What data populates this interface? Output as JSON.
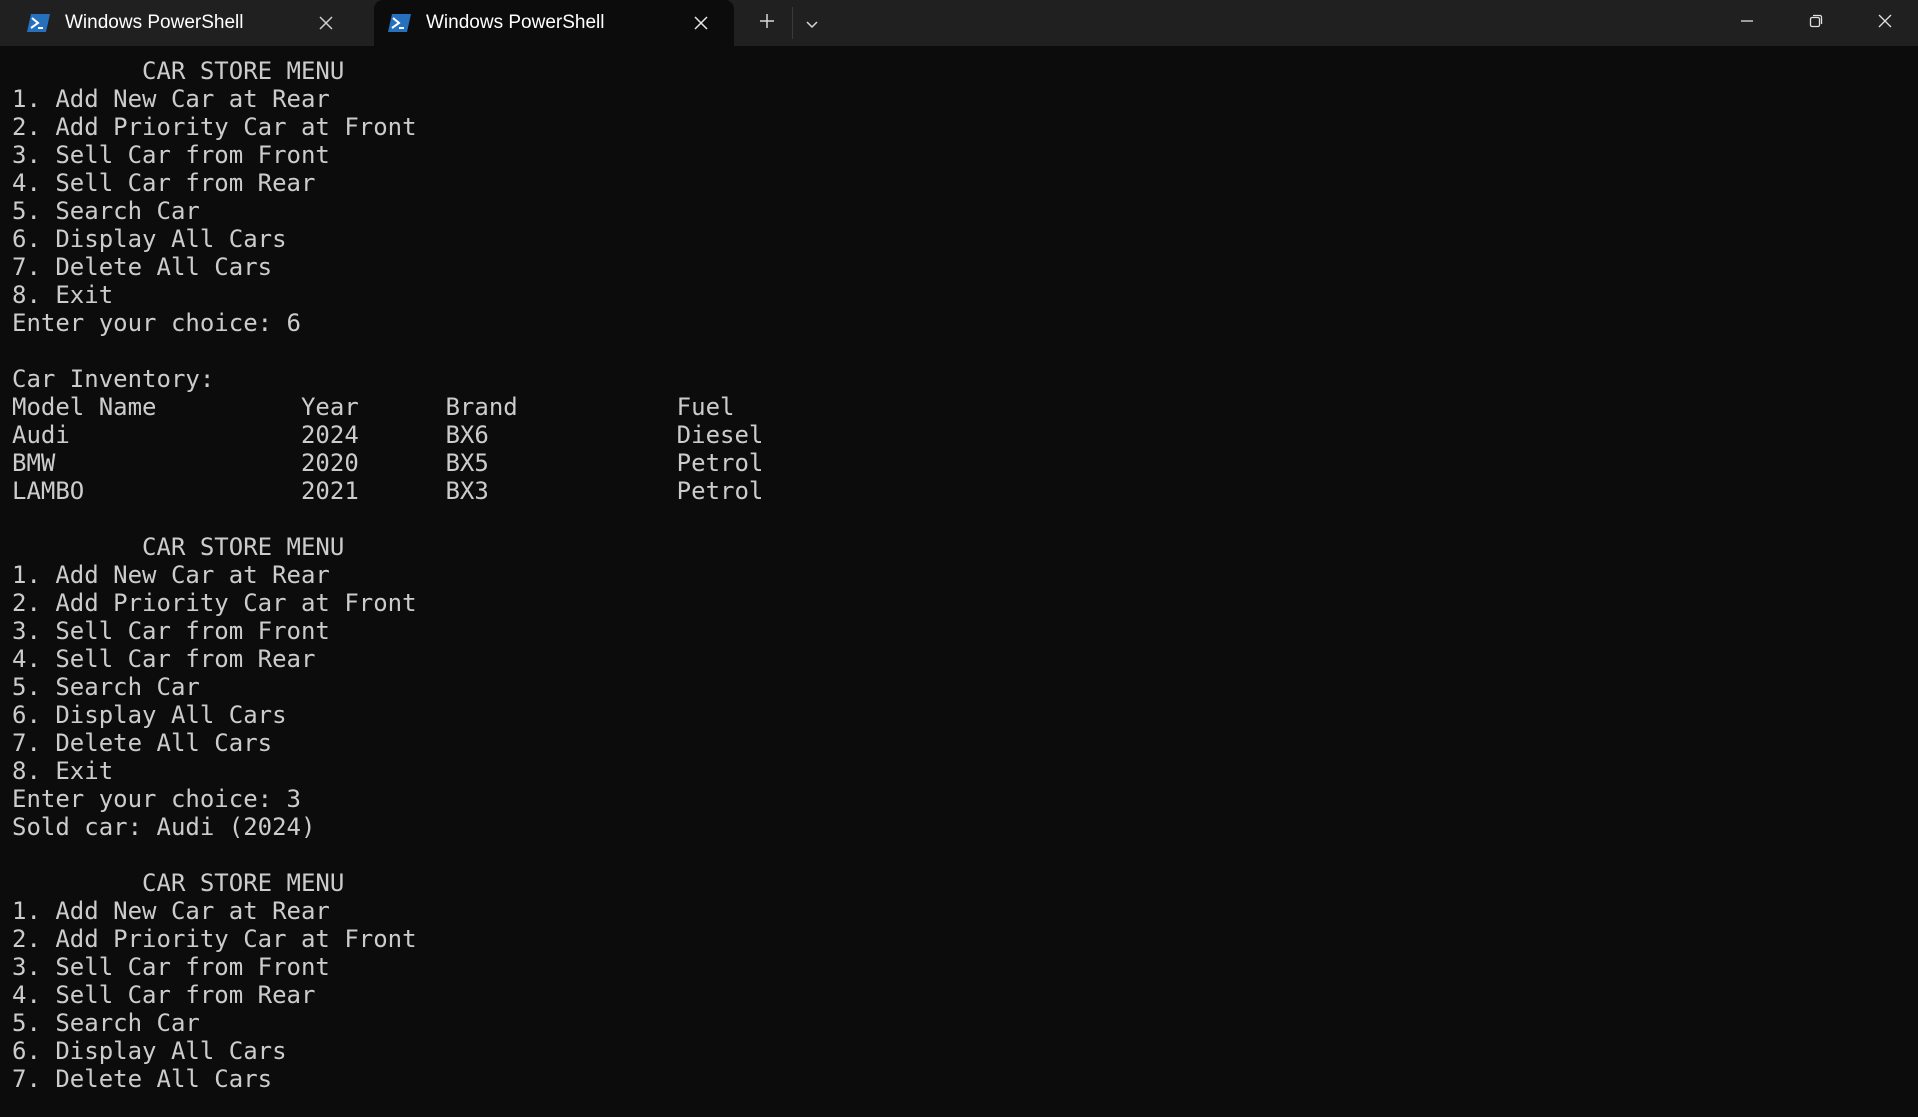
{
  "window": {
    "tabs": [
      {
        "label": "Windows PowerShell",
        "icon": "powershell-icon",
        "active": false
      },
      {
        "label": "Windows PowerShell",
        "icon": "powershell-icon",
        "active": true
      }
    ],
    "controls": [
      "new-tab-icon",
      "chevron-down-icon",
      "minimize-icon",
      "restore-icon",
      "close-icon"
    ]
  },
  "terminal": {
    "lines": [
      "         CAR STORE MENU",
      "1. Add New Car at Rear",
      "2. Add Priority Car at Front",
      "3. Sell Car from Front",
      "4. Sell Car from Rear",
      "5. Search Car",
      "6. Display All Cars",
      "7. Delete All Cars",
      "8. Exit",
      "Enter your choice: 6",
      "",
      "Car Inventory:",
      "Model Name          Year      Brand           Fuel",
      "Audi                2024      BX6             Diesel",
      "BMW                 2020      BX5             Petrol",
      "LAMBO               2021      BX3             Petrol",
      "",
      "         CAR STORE MENU",
      "1. Add New Car at Rear",
      "2. Add Priority Car at Front",
      "3. Sell Car from Front",
      "4. Sell Car from Rear",
      "5. Search Car",
      "6. Display All Cars",
      "7. Delete All Cars",
      "8. Exit",
      "Enter your choice: 3",
      "Sold car: Audi (2024)",
      "",
      "         CAR STORE MENU",
      "1. Add New Car at Rear",
      "2. Add Priority Car at Front",
      "3. Sell Car from Front",
      "4. Sell Car from Rear",
      "5. Search Car",
      "6. Display All Cars",
      "7. Delete All Cars"
    ]
  },
  "colors": {
    "titlebar": "#202020",
    "terminal_bg": "#0c0c0c",
    "terminal_fg": "#cccccc",
    "icon_blue": "#2671be"
  }
}
